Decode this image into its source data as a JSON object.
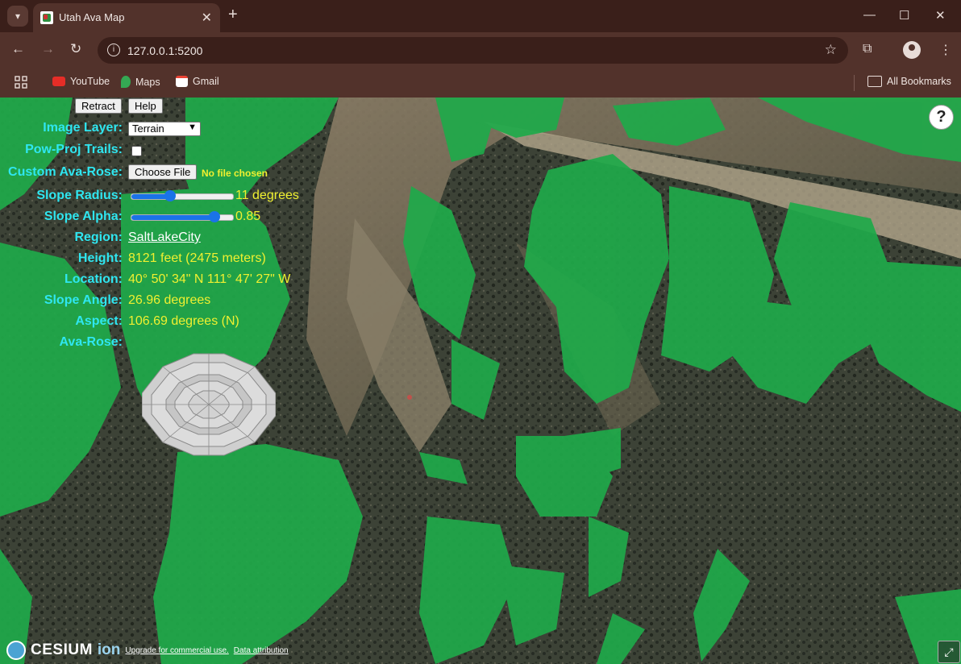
{
  "browser": {
    "tab_title": "Utah Ava Map",
    "url": "127.0.0.1:5200",
    "bookmarks": [
      {
        "label": "YouTube"
      },
      {
        "label": "Maps"
      },
      {
        "label": "Gmail"
      }
    ],
    "all_bookmarks": "All Bookmarks"
  },
  "panel": {
    "retract_label": "Retract",
    "help_label": "Help",
    "image_layer_label": "Image Layer:",
    "image_layer_value": "Terrain",
    "powproj_label": "Pow-Proj Trails:",
    "powproj_checked": false,
    "custom_rose_label": "Custom Ava-Rose:",
    "choose_file_label": "Choose File",
    "no_file_text": "No file chosen",
    "slope_radius_label": "Slope Radius:",
    "slope_radius_value": "11 degrees",
    "slope_radius_fraction": 0.38,
    "slope_alpha_label": "Slope Alpha:",
    "slope_alpha_value": "0.85",
    "slope_alpha_fraction": 0.82,
    "region_label": "Region:",
    "region_value": "SaltLakeCity",
    "height_label": "Height:",
    "height_value": "8121 feet (2475 meters)",
    "location_label": "Location:",
    "location_value": "40° 50' 34\" N 111° 47' 27\" W",
    "slope_angle_label": "Slope Angle:",
    "slope_angle_value": "26.96 degrees",
    "aspect_label": "Aspect:",
    "aspect_value": "106.69 degrees (N)",
    "ava_rose_label": "Ava-Rose:"
  },
  "map": {
    "help_icon": "?",
    "cesium_brand": "CESIUM",
    "cesium_ion": "ion",
    "upgrade_link": "Upgrade for commercial use.",
    "attribution_link": "Data attribution",
    "slope_color": "#1faa4a"
  }
}
